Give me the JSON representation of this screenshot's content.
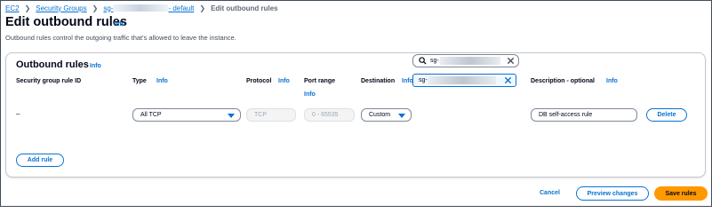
{
  "breadcrumb": {
    "items": [
      "EC2",
      "Security Groups"
    ],
    "sg_prefix": "sg-",
    "sg_suffix": "- default",
    "current": "Edit outbound rules"
  },
  "header": {
    "title": "Edit outbound rules",
    "info": "Info",
    "description": "Outbound rules control the outgoing traffic that's allowed to leave the instance."
  },
  "panel": {
    "title": "Outbound rules",
    "info": "Info",
    "columns": {
      "rule_id": "Security group rule ID",
      "type": "Type",
      "protocol": "Protocol",
      "port_range": "Port range",
      "destination": "Destination",
      "description": "Description - optional"
    },
    "info_label": "Info",
    "row": {
      "rule_id": "–",
      "type": "All TCP",
      "protocol": "TCP",
      "port_range": "0 - 65535",
      "destination_mode": "Custom",
      "destination_search": "sg-",
      "destination_token": "sg-",
      "description": "DB self-access rule",
      "delete_label": "Delete"
    },
    "add_rule_label": "Add rule"
  },
  "footer": {
    "cancel_label": "Cancel",
    "preview_label": "Preview changes",
    "save_label": "Save rules"
  },
  "colors": {
    "link": "#0972d3",
    "primary": "#ff9900",
    "border": "#7d8998"
  }
}
